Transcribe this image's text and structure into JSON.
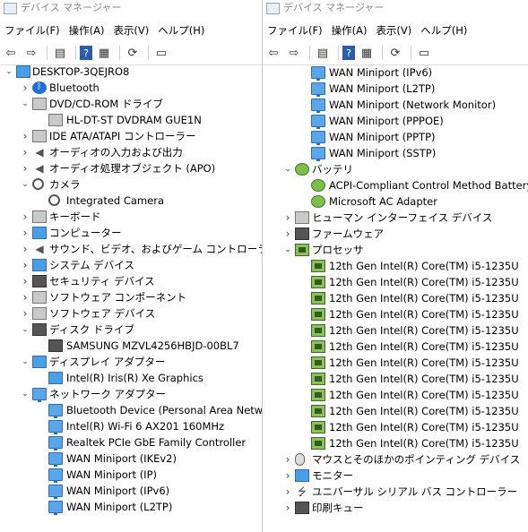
{
  "left": {
    "title": "デバイス マネージャー",
    "menu": [
      "ファイル(F)",
      "操作(A)",
      "表示(V)",
      "ヘルプ(H)"
    ],
    "toolbar": [
      "back-icon",
      "forward-icon",
      "sep",
      "properties-icon",
      "sep",
      "help-icon",
      "view-icon",
      "sep",
      "scan-hardware-icon",
      "sep",
      "monitor-icon"
    ],
    "tree": [
      {
        "label": "DESKTOP-3QEJRO8",
        "level": 0,
        "chev": "down",
        "icon": "computer-icon"
      },
      {
        "label": "Bluetooth",
        "level": 1,
        "chev": "right",
        "icon": "bluetooth-icon"
      },
      {
        "label": "DVD/CD-ROM ドライブ",
        "level": 1,
        "chev": "down",
        "icon": "dvd-drive-icon"
      },
      {
        "label": "HL-DT-ST DVDRAM GUE1N",
        "level": 2,
        "chev": "",
        "icon": "dvd-drive-icon"
      },
      {
        "label": "IDE ATA/ATAPI コントローラー",
        "level": 1,
        "chev": "right",
        "icon": "ide-controller-icon"
      },
      {
        "label": "オーディオの入力および出力",
        "level": 1,
        "chev": "right",
        "icon": "speaker-icon"
      },
      {
        "label": "オーディオ処理オブジェクト (APO)",
        "level": 1,
        "chev": "right",
        "icon": "speaker-icon"
      },
      {
        "label": "カメラ",
        "level": 1,
        "chev": "down",
        "icon": "camera-icon"
      },
      {
        "label": "Integrated Camera",
        "level": 2,
        "chev": "",
        "icon": "camera-icon"
      },
      {
        "label": "キーボード",
        "level": 1,
        "chev": "right",
        "icon": "keyboard-icon"
      },
      {
        "label": "コンピューター",
        "level": 1,
        "chev": "right",
        "icon": "monitor-icon"
      },
      {
        "label": "サウンド、ビデオ、およびゲーム コントローラー",
        "level": 1,
        "chev": "right",
        "icon": "speaker-icon"
      },
      {
        "label": "システム デバイス",
        "level": 1,
        "chev": "right",
        "icon": "system-device-icon"
      },
      {
        "label": "セキュリティ デバイス",
        "level": 1,
        "chev": "right",
        "icon": "security-device-icon"
      },
      {
        "label": "ソフトウェア コンポーネント",
        "level": 1,
        "chev": "right",
        "icon": "software-component-icon"
      },
      {
        "label": "ソフトウェア デバイス",
        "level": 1,
        "chev": "right",
        "icon": "software-device-icon"
      },
      {
        "label": "ディスク ドライブ",
        "level": 1,
        "chev": "down",
        "icon": "disk-drive-icon"
      },
      {
        "label": "SAMSUNG MZVL4256HBJD-00BL7",
        "level": 2,
        "chev": "",
        "icon": "disk-drive-icon"
      },
      {
        "label": "ディスプレイ アダプター",
        "level": 1,
        "chev": "down",
        "icon": "display-adapter-icon"
      },
      {
        "label": "Intel(R) Iris(R) Xe Graphics",
        "level": 2,
        "chev": "",
        "icon": "display-adapter-icon"
      },
      {
        "label": "ネットワーク アダプター",
        "level": 1,
        "chev": "down",
        "icon": "network-adapter-icon"
      },
      {
        "label": "Bluetooth Device (Personal Area Network)",
        "level": 2,
        "chev": "",
        "icon": "network-adapter-icon"
      },
      {
        "label": "Intel(R) Wi-Fi 6 AX201 160MHz",
        "level": 2,
        "chev": "",
        "icon": "network-adapter-icon"
      },
      {
        "label": "Realtek PCIe GbE Family Controller",
        "level": 2,
        "chev": "",
        "icon": "network-adapter-icon"
      },
      {
        "label": "WAN Miniport (IKEv2)",
        "level": 2,
        "chev": "",
        "icon": "network-adapter-icon"
      },
      {
        "label": "WAN Miniport (IP)",
        "level": 2,
        "chev": "",
        "icon": "network-adapter-icon"
      },
      {
        "label": "WAN Miniport (IPv6)",
        "level": 2,
        "chev": "",
        "icon": "network-adapter-icon"
      },
      {
        "label": "WAN Miniport (L2TP)",
        "level": 2,
        "chev": "",
        "icon": "network-adapter-icon"
      }
    ]
  },
  "right": {
    "title": "デバイス マネージャー",
    "menu": [
      "ファイル(F)",
      "操作(A)",
      "表示(V)",
      "ヘルプ(H)"
    ],
    "toolbar": [
      "back-icon",
      "forward-icon",
      "sep",
      "properties-icon",
      "sep",
      "help-icon",
      "view-icon",
      "sep",
      "scan-hardware-icon",
      "sep",
      "monitor-icon"
    ],
    "tree": [
      {
        "label": "WAN Miniport (IPv6)",
        "level": 2,
        "chev": "",
        "icon": "network-adapter-icon"
      },
      {
        "label": "WAN Miniport (L2TP)",
        "level": 2,
        "chev": "",
        "icon": "network-adapter-icon"
      },
      {
        "label": "WAN Miniport (Network Monitor)",
        "level": 2,
        "chev": "",
        "icon": "network-adapter-icon"
      },
      {
        "label": "WAN Miniport (PPPOE)",
        "level": 2,
        "chev": "",
        "icon": "network-adapter-icon"
      },
      {
        "label": "WAN Miniport (PPTP)",
        "level": 2,
        "chev": "",
        "icon": "network-adapter-icon"
      },
      {
        "label": "WAN Miniport (SSTP)",
        "level": 2,
        "chev": "",
        "icon": "network-adapter-icon"
      },
      {
        "label": "バッテリ",
        "level": 1,
        "chev": "down",
        "icon": "battery-icon"
      },
      {
        "label": "ACPI-Compliant Control Method Battery",
        "level": 2,
        "chev": "",
        "icon": "battery-icon"
      },
      {
        "label": "Microsoft AC Adapter",
        "level": 2,
        "chev": "",
        "icon": "battery-icon"
      },
      {
        "label": "ヒューマン インターフェイス デバイス",
        "level": 1,
        "chev": "right",
        "icon": "hid-icon"
      },
      {
        "label": "ファームウェア",
        "level": 1,
        "chev": "right",
        "icon": "firmware-icon"
      },
      {
        "label": "プロセッサ",
        "level": 1,
        "chev": "down",
        "icon": "processor-icon"
      },
      {
        "label": "12th Gen Intel(R) Core(TM) i5-1235U",
        "level": 2,
        "chev": "",
        "icon": "processor-icon"
      },
      {
        "label": "12th Gen Intel(R) Core(TM) i5-1235U",
        "level": 2,
        "chev": "",
        "icon": "processor-icon"
      },
      {
        "label": "12th Gen Intel(R) Core(TM) i5-1235U",
        "level": 2,
        "chev": "",
        "icon": "processor-icon"
      },
      {
        "label": "12th Gen Intel(R) Core(TM) i5-1235U",
        "level": 2,
        "chev": "",
        "icon": "processor-icon"
      },
      {
        "label": "12th Gen Intel(R) Core(TM) i5-1235U",
        "level": 2,
        "chev": "",
        "icon": "processor-icon"
      },
      {
        "label": "12th Gen Intel(R) Core(TM) i5-1235U",
        "level": 2,
        "chev": "",
        "icon": "processor-icon"
      },
      {
        "label": "12th Gen Intel(R) Core(TM) i5-1235U",
        "level": 2,
        "chev": "",
        "icon": "processor-icon"
      },
      {
        "label": "12th Gen Intel(R) Core(TM) i5-1235U",
        "level": 2,
        "chev": "",
        "icon": "processor-icon"
      },
      {
        "label": "12th Gen Intel(R) Core(TM) i5-1235U",
        "level": 2,
        "chev": "",
        "icon": "processor-icon"
      },
      {
        "label": "12th Gen Intel(R) Core(TM) i5-1235U",
        "level": 2,
        "chev": "",
        "icon": "processor-icon"
      },
      {
        "label": "12th Gen Intel(R) Core(TM) i5-1235U",
        "level": 2,
        "chev": "",
        "icon": "processor-icon"
      },
      {
        "label": "12th Gen Intel(R) Core(TM) i5-1235U",
        "level": 2,
        "chev": "",
        "icon": "processor-icon"
      },
      {
        "label": "マウスとそのほかのポインティング デバイス",
        "level": 1,
        "chev": "right",
        "icon": "mouse-icon"
      },
      {
        "label": "モニター",
        "level": 1,
        "chev": "right",
        "icon": "monitor-icon"
      },
      {
        "label": "ユニバーサル シリアル バス コントローラー",
        "level": 1,
        "chev": "right",
        "icon": "usb-icon"
      },
      {
        "label": "印刷キュー",
        "level": 1,
        "chev": "right",
        "icon": "printer-icon"
      }
    ]
  }
}
